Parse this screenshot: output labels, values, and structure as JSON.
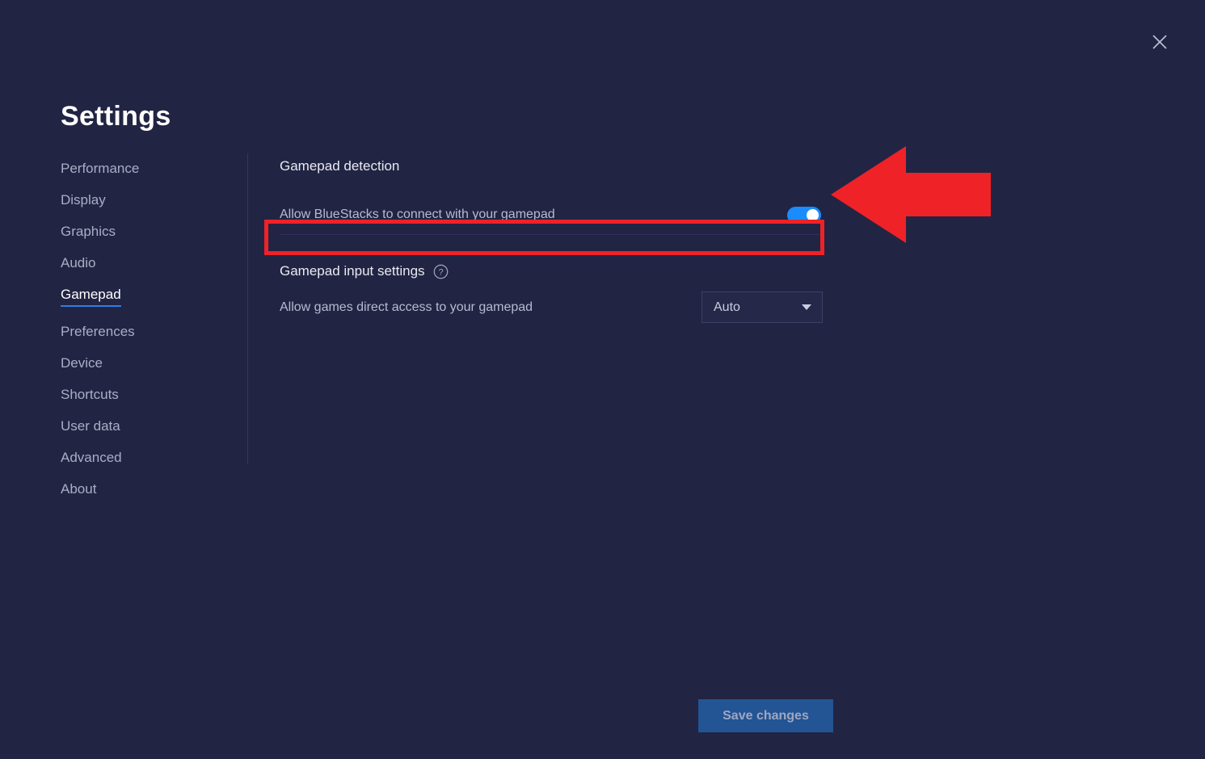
{
  "window": {
    "title": "Settings",
    "close_icon": "close-icon"
  },
  "sidebar": {
    "items": [
      {
        "label": "Performance",
        "active": false
      },
      {
        "label": "Display",
        "active": false
      },
      {
        "label": "Graphics",
        "active": false
      },
      {
        "label": "Audio",
        "active": false
      },
      {
        "label": "Gamepad",
        "active": true
      },
      {
        "label": "Preferences",
        "active": false
      },
      {
        "label": "Device",
        "active": false
      },
      {
        "label": "Shortcuts",
        "active": false
      },
      {
        "label": "User data",
        "active": false
      },
      {
        "label": "Advanced",
        "active": false
      },
      {
        "label": "About",
        "active": false
      }
    ]
  },
  "main": {
    "detection": {
      "heading": "Gamepad detection",
      "row_label": "Allow BlueStacks to connect with your gamepad",
      "toggle_state": "on"
    },
    "input_settings": {
      "heading": "Gamepad input settings",
      "help_icon": "help-circle-icon",
      "row_label": "Allow games direct access to your gamepad",
      "select_value": "Auto"
    }
  },
  "annotation": {
    "highlight_color": "#ee2227",
    "arrow_color": "#ee2227",
    "arrow_direction": "left"
  },
  "footer": {
    "save_label": "Save changes"
  },
  "colors": {
    "background": "#222443",
    "accent_blue": "#1a8cff",
    "active_underline": "#2f7de1",
    "save_button_bg": "#235494"
  }
}
